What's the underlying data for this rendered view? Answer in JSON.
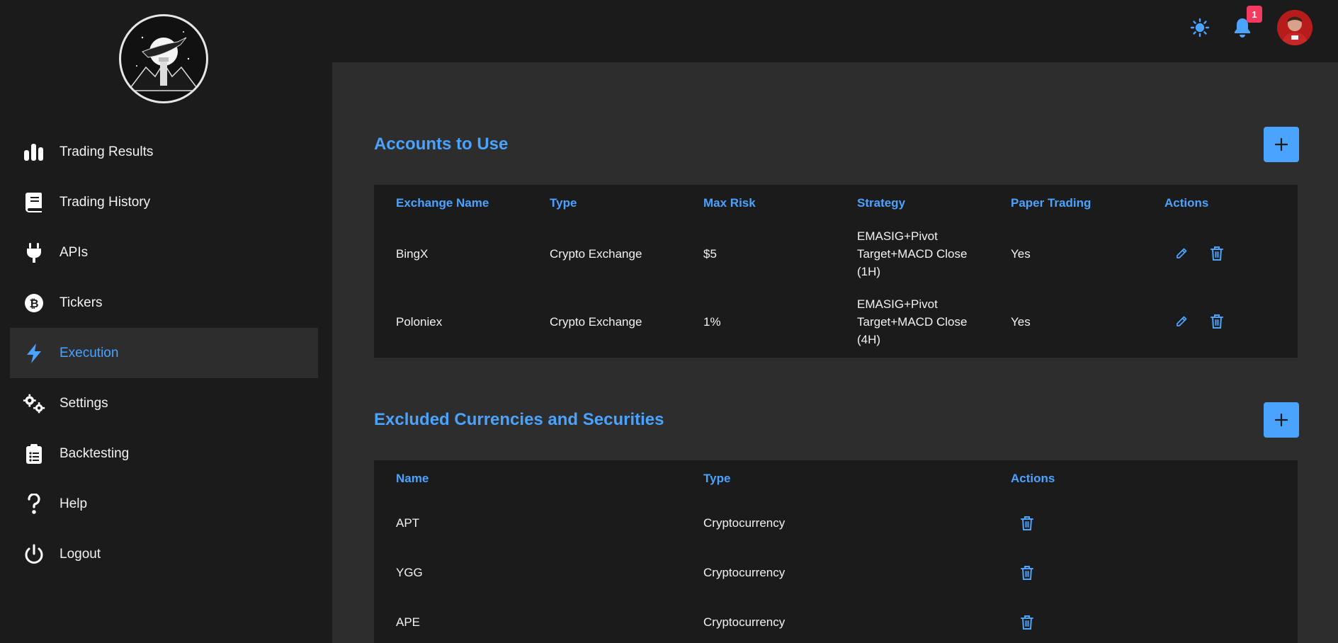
{
  "sidebar": {
    "logo": "hummingbird-lighthouse-logo",
    "items": [
      {
        "label": "Trading Results",
        "icon": "bar-chart-icon"
      },
      {
        "label": "Trading History",
        "icon": "book-icon"
      },
      {
        "label": "APIs",
        "icon": "plug-icon"
      },
      {
        "label": "Tickers",
        "icon": "bitcoin-icon"
      },
      {
        "label": "Execution",
        "icon": "bolt-icon",
        "active": true
      },
      {
        "label": "Settings",
        "icon": "gears-icon"
      },
      {
        "label": "Backtesting",
        "icon": "clipboard-list-icon"
      },
      {
        "label": "Help",
        "icon": "question-icon"
      },
      {
        "label": "Logout",
        "icon": "power-icon"
      }
    ]
  },
  "header": {
    "theme_icon": "sun-icon",
    "notification_icon": "bell-icon",
    "notification_count": "1",
    "avatar": "user-avatar"
  },
  "accounts": {
    "title": "Accounts to Use",
    "columns": [
      "Exchange Name",
      "Type",
      "Max Risk",
      "Strategy",
      "Paper Trading",
      "Actions"
    ],
    "rows": [
      {
        "exchange": "BingX",
        "type": "Crypto Exchange",
        "max_risk": "$5",
        "strategy_lines": [
          "EMASIG+Pivot",
          "Target+MACD Close",
          "(1H)"
        ],
        "paper": "Yes"
      },
      {
        "exchange": "Poloniex",
        "type": "Crypto Exchange",
        "max_risk": "1%",
        "strategy_lines": [
          "EMASIG+Pivot",
          "Target+MACD Close",
          "(4H)"
        ],
        "paper": "Yes"
      }
    ]
  },
  "excluded": {
    "title": "Excluded Currencies and Securities",
    "columns": [
      "Name",
      "Type",
      "Actions"
    ],
    "rows": [
      {
        "name": "APT",
        "type": "Cryptocurrency"
      },
      {
        "name": "YGG",
        "type": "Cryptocurrency"
      },
      {
        "name": "APE",
        "type": "Cryptocurrency"
      }
    ]
  },
  "colors": {
    "accent": "#4aa3ff",
    "badge": "#f23b5f",
    "panel": "#1b1b1b",
    "main": "#2d2d2d"
  }
}
